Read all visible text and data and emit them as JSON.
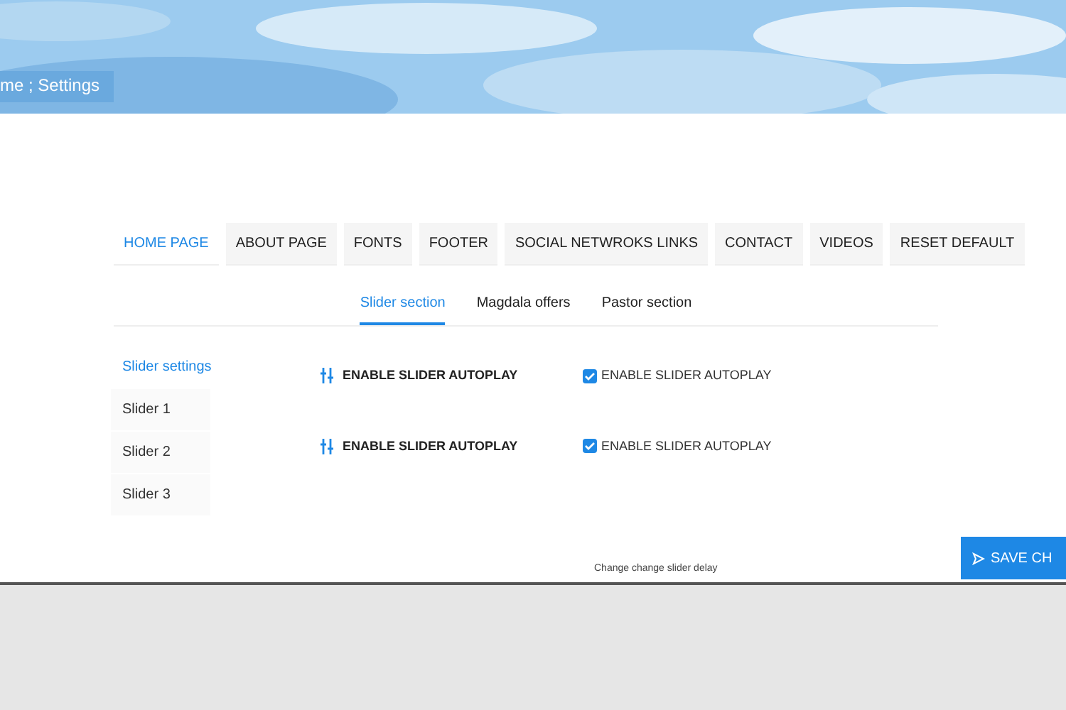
{
  "breadcrumb": "me ; Settings",
  "tabs": [
    {
      "label": "HOME PAGE",
      "selected": true
    },
    {
      "label": "ABOUT PAGE",
      "selected": false
    },
    {
      "label": "FONTS",
      "selected": false
    },
    {
      "label": "FOOTER",
      "selected": false
    },
    {
      "label": "SOCIAL NETWROKS LINKS",
      "selected": false
    },
    {
      "label": "CONTACT",
      "selected": false
    },
    {
      "label": "VIDEOS",
      "selected": false
    },
    {
      "label": "RESET DEFAULT",
      "selected": false
    }
  ],
  "subtabs": [
    {
      "label": "Slider section",
      "selected": true
    },
    {
      "label": "Magdala offers",
      "selected": false
    },
    {
      "label": "Pastor section",
      "selected": false
    }
  ],
  "sidebar": {
    "items": [
      {
        "label": "Slider settings",
        "selected": true
      },
      {
        "label": "Slider 1",
        "selected": false
      },
      {
        "label": "Slider 2",
        "selected": false
      },
      {
        "label": "Slider 3",
        "selected": false
      }
    ]
  },
  "settings": [
    {
      "label": "ENABLE SLIDER AUTOPLAY",
      "checkbox_label": "ENABLE SLIDER AUTOPLAY",
      "checked": true
    },
    {
      "label": "ENABLE SLIDER AUTOPLAY",
      "checkbox_label": "ENABLE SLIDER AUTOPLAY",
      "checked": true
    }
  ],
  "delay_label": "Change change slider delay",
  "save_button": "SAVE CH"
}
